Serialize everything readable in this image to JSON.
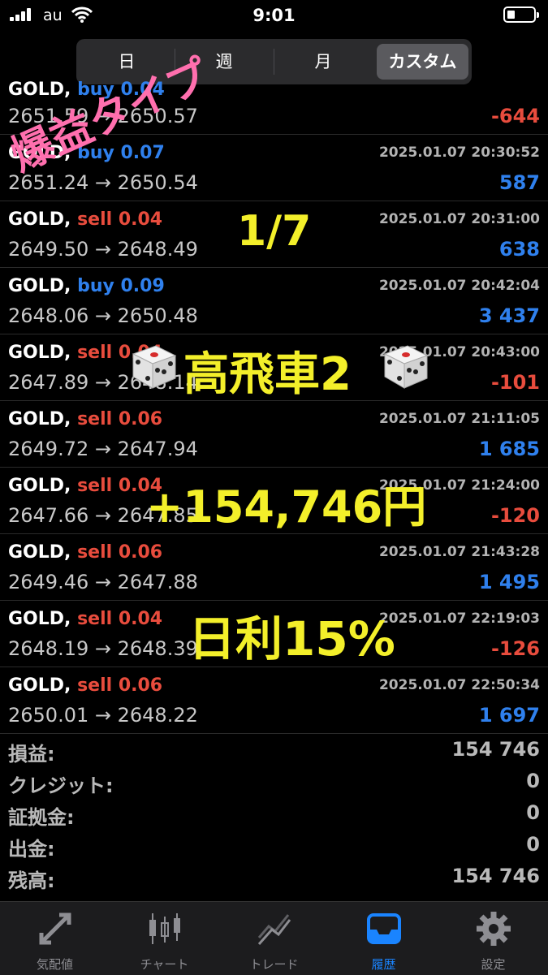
{
  "status_bar": {
    "carrier": "au",
    "time": "9:01"
  },
  "segments": [
    {
      "label": "日"
    },
    {
      "label": "週"
    },
    {
      "label": "月"
    },
    {
      "label": "カスタム",
      "active": true
    }
  ],
  "deals": [
    {
      "prices": "2651.59 → 2650.57",
      "profit": "-644",
      "sign": "neg"
    },
    {
      "symbol": "GOLD,",
      "dir": "buy 0.07",
      "side": "buy",
      "time": "2025.01.07 20:30:52",
      "prices": "2651.24 → 2650.54",
      "profit": "587",
      "sign": "pos"
    },
    {
      "symbol": "GOLD,",
      "dir": "sell 0.04",
      "side": "sell",
      "time": "2025.01.07 20:31:00",
      "prices": "2649.50 → 2648.49",
      "profit": "638",
      "sign": "pos"
    },
    {
      "symbol": "GOLD,",
      "dir": "buy 0.09",
      "side": "buy",
      "time": "2025.01.07 20:42:04",
      "prices": "2648.06 → 2650.48",
      "profit": "3 437",
      "sign": "pos"
    },
    {
      "symbol": "GOLD,",
      "dir": "sell 0.04",
      "side": "sell",
      "time": "2025.01.07 20:43:00",
      "prices": "2647.89 → 2648.14",
      "profit": "-101",
      "sign": "neg"
    },
    {
      "symbol": "GOLD,",
      "dir": "sell 0.06",
      "side": "sell",
      "time": "2025.01.07 21:11:05",
      "prices": "2649.72 → 2647.94",
      "profit": "1 685",
      "sign": "pos"
    },
    {
      "symbol": "GOLD,",
      "dir": "sell 0.04",
      "side": "sell",
      "time": "2025.01.07 21:24:00",
      "prices": "2647.66 → 2647.85",
      "profit": "-120",
      "sign": "neg"
    },
    {
      "symbol": "GOLD,",
      "dir": "sell 0.06",
      "side": "sell",
      "time": "2025.01.07 21:43:28",
      "prices": "2649.46 → 2647.88",
      "profit": "1 495",
      "sign": "pos"
    },
    {
      "symbol": "GOLD,",
      "dir": "sell 0.04",
      "side": "sell",
      "time": "2025.01.07 22:19:03",
      "prices": "2648.19 → 2648.39",
      "profit": "-126",
      "sign": "neg"
    },
    {
      "symbol": "GOLD,",
      "dir": "sell 0.06",
      "side": "sell",
      "time": "2025.01.07 22:50:34",
      "prices": "2650.01 → 2648.22",
      "profit": "1 697",
      "sign": "pos"
    }
  ],
  "summary": [
    {
      "label": "損益:",
      "value": "154 746"
    },
    {
      "label": "クレジット:",
      "value": "0"
    },
    {
      "label": "証拠金:",
      "value": "0"
    },
    {
      "label": "出金:",
      "value": "0"
    },
    {
      "label": "残高:",
      "value": "154 746"
    }
  ],
  "tabs": [
    {
      "label": "気配値",
      "icon": "quotes-icon"
    },
    {
      "label": "チャート",
      "icon": "chart-icon"
    },
    {
      "label": "トレード",
      "icon": "trade-icon"
    },
    {
      "label": "履歴",
      "icon": "history-icon",
      "active": true
    },
    {
      "label": "設定",
      "icon": "settings-icon"
    }
  ],
  "overlay": {
    "type_text": "爆益タイプ",
    "date_text": "1/7",
    "strategy_text": "高飛車2",
    "profit_text": "+154,746円",
    "rate_text": "日利15%"
  },
  "colors": {
    "buy": "#2f80ed",
    "sell": "#e84c3d",
    "active_tab": "#1a84ff",
    "overlay_yellow": "#f3ef2a",
    "overlay_pink": "#ff6fae"
  }
}
